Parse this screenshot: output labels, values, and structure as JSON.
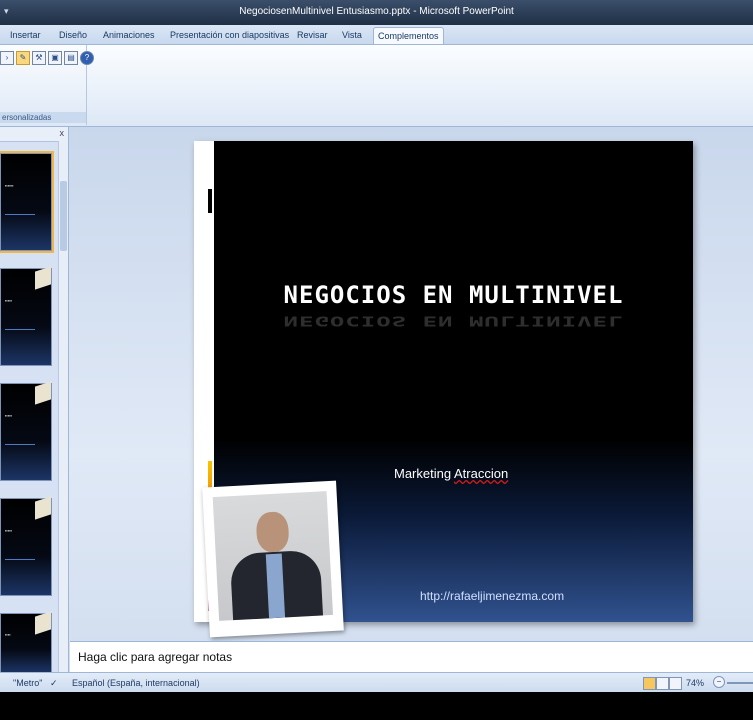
{
  "window": {
    "title": "NegociosenMultinivel Entusiasmo.pptx - Microsoft PowerPoint",
    "qa_glyph": "▾"
  },
  "tabs": [
    {
      "label": "Insertar"
    },
    {
      "label": "Diseño"
    },
    {
      "label": "Animaciones"
    },
    {
      "label": "Presentación con diapositivas"
    },
    {
      "label": "Revisar"
    },
    {
      "label": "Vista"
    },
    {
      "label": "Complementos",
      "active": true
    }
  ],
  "ribbon": {
    "group_label": "ersonalizadas",
    "icons": [
      "pointer-icon",
      "brush-icon",
      "tool-icon",
      "save-icon",
      "chart-icon",
      "help-icon"
    ]
  },
  "panel": {
    "close_label": "x"
  },
  "slide": {
    "heading": "NEGOCIOS EN MULTINIVEL",
    "subtitle_prefix": "Marketing ",
    "subtitle_underlined": "Atraccion",
    "url": "http://rafaeljimenezma.com"
  },
  "notes": {
    "placeholder": "Haga clic para agregar notas"
  },
  "status": {
    "theme": "\"Metro\"",
    "language": "Español (España, internacional)",
    "zoom": "74%",
    "zoom_minus": "−"
  },
  "colors": {
    "ribbon_bg": "#dde8f6",
    "slide_bg_top": "#000000",
    "slide_bg_bottom": "#30528f",
    "accent_selected": "#f0b646"
  }
}
